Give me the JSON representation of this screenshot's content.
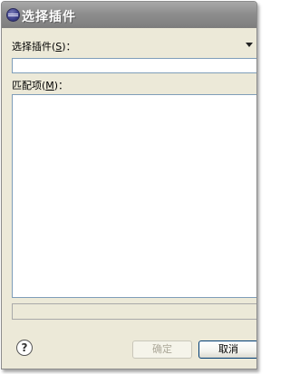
{
  "window": {
    "title": "选择插件"
  },
  "select_label": {
    "text": "选择插件",
    "mnemonic": "S",
    "suffix": "："
  },
  "search": {
    "value": ""
  },
  "matches_label": {
    "text": "匹配项",
    "mnemonic": "M",
    "suffix": "："
  },
  "matches": [],
  "status": {
    "text": ""
  },
  "buttons": {
    "ok": "确定",
    "cancel": "取消"
  },
  "help": {
    "glyph": "?"
  }
}
